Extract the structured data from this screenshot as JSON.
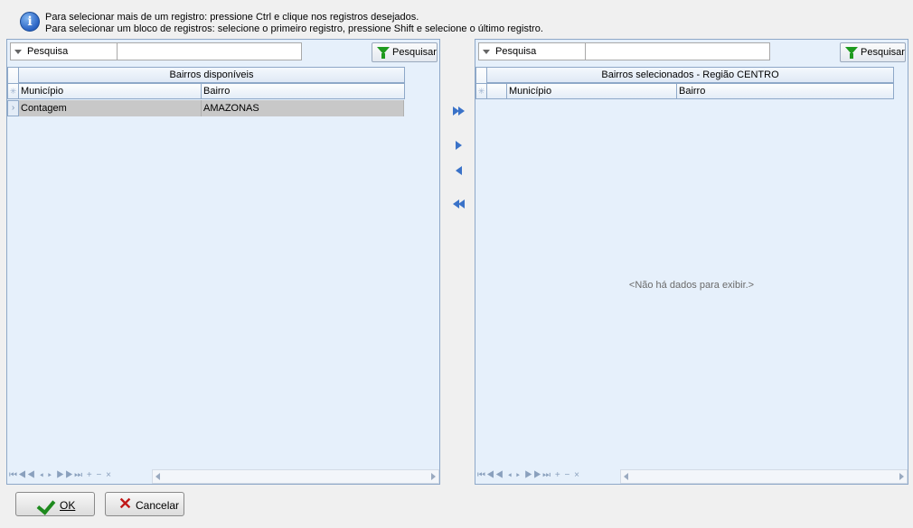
{
  "info": {
    "line1": "Para selecionar mais de um registro: pressione Ctrl e clique nos registros desejados.",
    "line2": "Para selecionar um bloco de registros: selecione o primeiro registro, pressione Shift e selecione o último registro."
  },
  "left": {
    "search_label": "Pesquisa",
    "search_value": "",
    "search_button": "Pesquisar",
    "grid_title": "Bairros disponíveis",
    "columns": [
      "Município",
      "Bairro"
    ],
    "rows": [
      {
        "municipio": "Contagem",
        "bairro": "AMAZONAS"
      }
    ]
  },
  "right": {
    "search_label": "Pesquisa",
    "search_value": "",
    "search_button": "Pesquisar",
    "grid_title": "Bairros selecionados - Região CENTRO",
    "columns": [
      "Município",
      "Bairro"
    ],
    "empty_message": "<Não há dados para exibir.>"
  },
  "navigator": "⏮◀◀ ◂ ▸ ▶▶⏭ + − ×",
  "buttons": {
    "ok": "OK",
    "cancel": "Cancelar"
  },
  "colors": {
    "panel_bg": "#e6f0fb",
    "border": "#8ea8c8",
    "selected_row": "#c8c8c8",
    "arrow": "#3a72c8"
  }
}
